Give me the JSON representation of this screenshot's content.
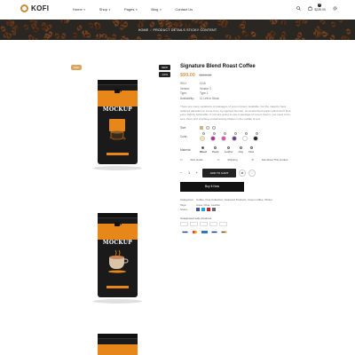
{
  "header": {
    "logo": "KOFI",
    "nav": [
      {
        "label": "Home"
      },
      {
        "label": "Shop"
      },
      {
        "label": "Pages"
      },
      {
        "label": "Blog"
      },
      {
        "label": "Contact Us"
      }
    ],
    "cart_count": "0",
    "cart_total": "$239.00"
  },
  "banner": {
    "breadcrumb_home": "HOME",
    "breadcrumb_current": "PRODUCT DETAILS STICKY CONTENT"
  },
  "gallery": {
    "sale_badge": "Sale",
    "new_badge": "NEW",
    "discount_badge": "-10%",
    "bag_text": "MOCKUP"
  },
  "product": {
    "title": "Signature Blend Roast Coffee",
    "price": "$99.00",
    "old_price": "$110.00",
    "meta": [
      {
        "k": "SKU:",
        "v": "1116"
      },
      {
        "k": "Vendor:",
        "v": "Vendor 3"
      },
      {
        "k": "Type:",
        "v": "Type 1"
      },
      {
        "k": "Availability:",
        "v": "11 Left In Stock"
      }
    ],
    "description": "There are many variations of passages of Lorem Ipsum available, but the majority have suffered alteration in some form, by injected humour, or randomised words which don't look even slightly believable. If you are going to use a passage of Lorem Ipsum, you need to be sure there isn't anything embarrassing hidden in the middle of text.",
    "size_label": "Size:",
    "color_label": "Color:",
    "material_label": "Material:",
    "materials": [
      "Wood",
      "Plastic",
      "Leather",
      "Clay",
      "Fiber"
    ],
    "size_guide": "Size Guide",
    "shipping": "Shipping",
    "ask": "Ask About This product",
    "qty": "1",
    "add_to_cart": "ADD TO CART",
    "buy_now": "Buy It Now",
    "categories_label": "Categories:",
    "categories": "Coffee, Fine Collection, Featured Products, Green coffee, Winter",
    "tags_label": "Tags:",
    "tags": "Aqua, Fiber, Leather",
    "share_label": "Share:",
    "guarantee": "Guaranteed safe checkout"
  },
  "colors": {
    "accent": "#d99a4e",
    "bag_band": "#e7871a",
    "dark": "#222222"
  }
}
